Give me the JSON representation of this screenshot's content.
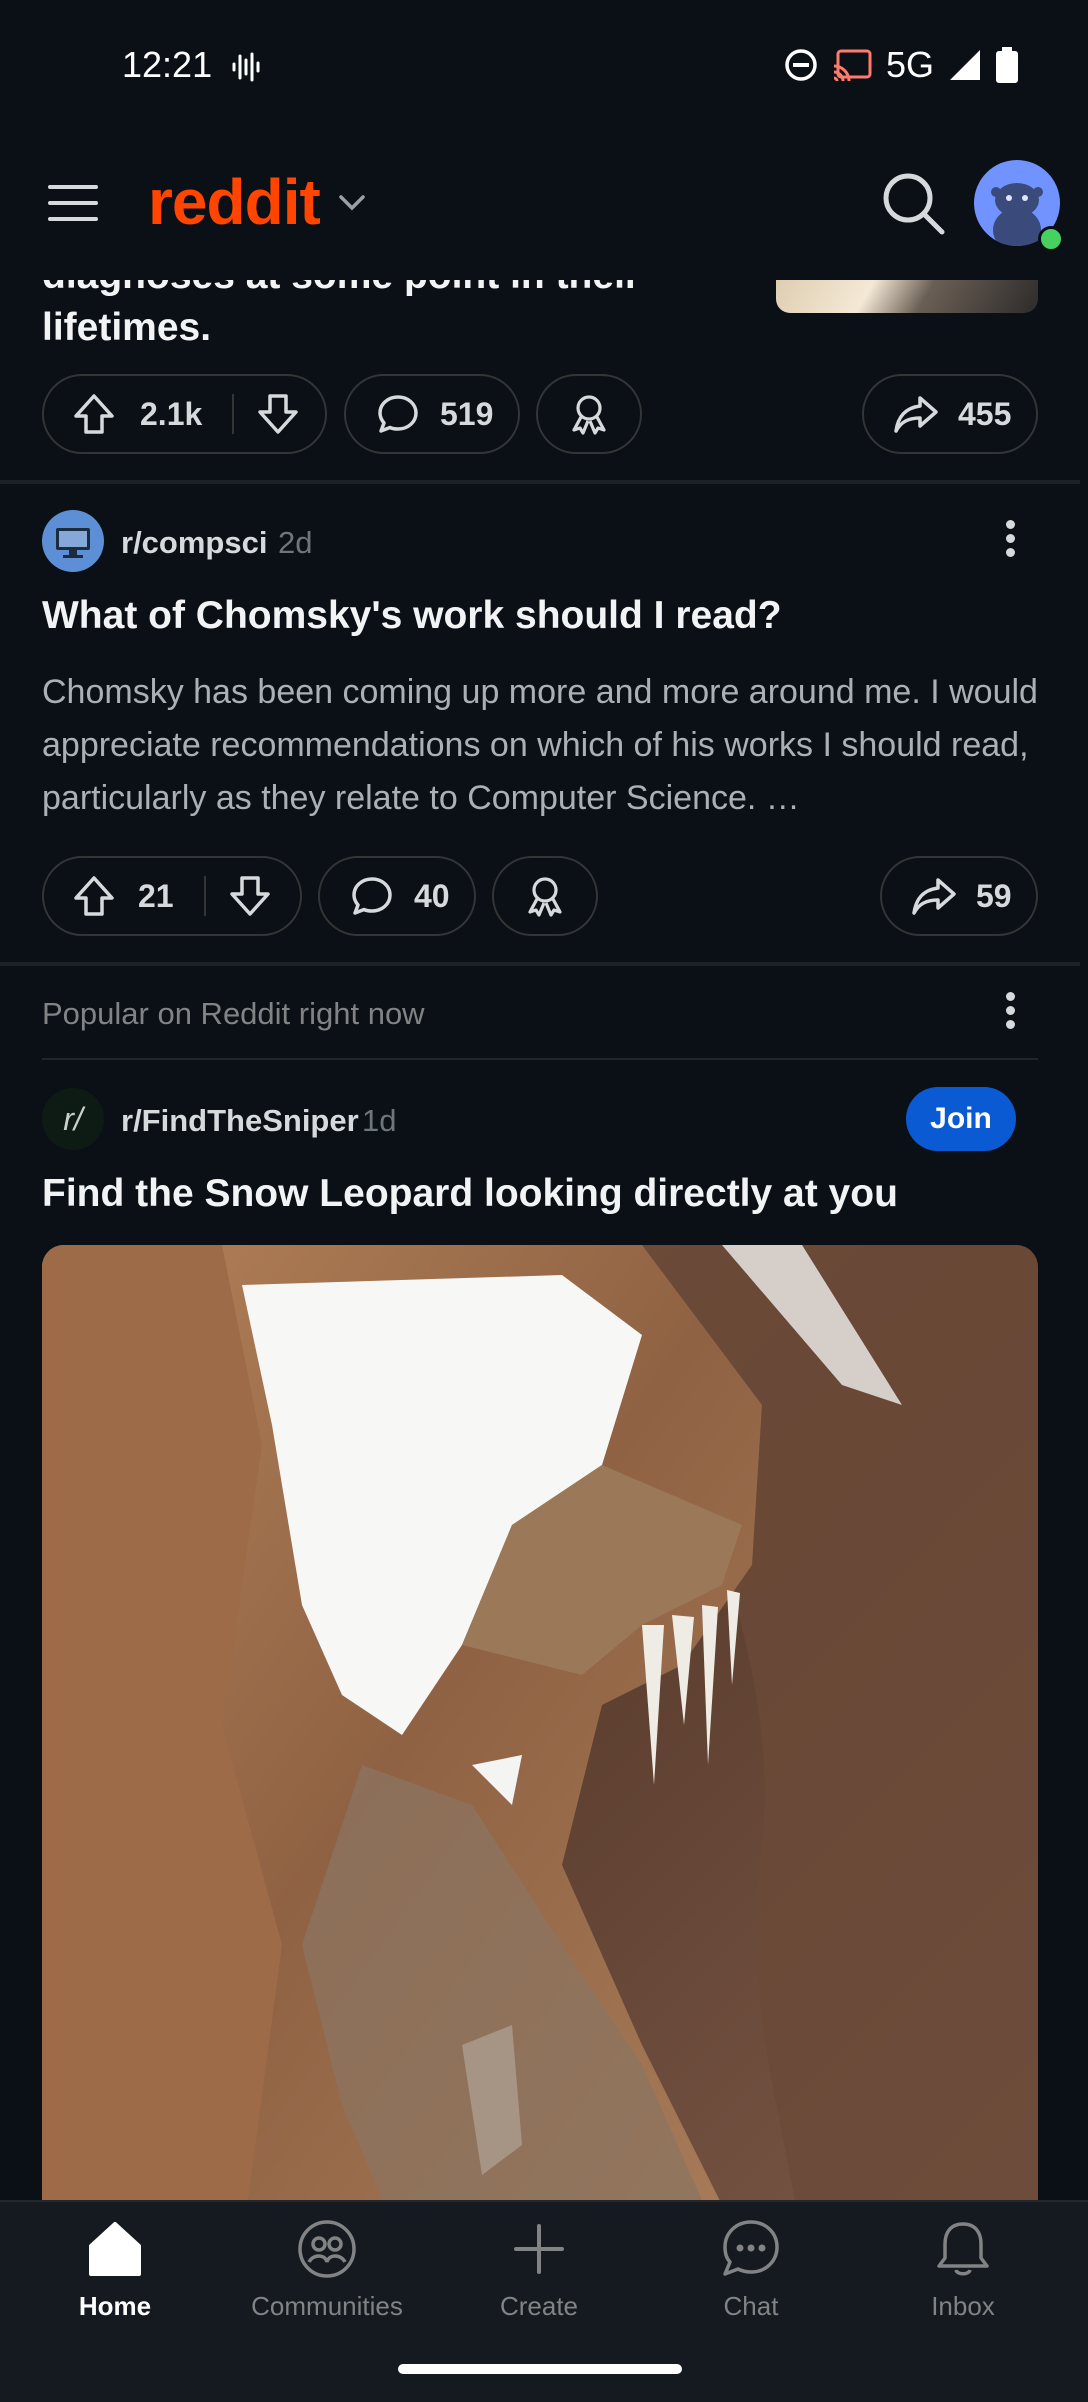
{
  "status": {
    "time": "12:21",
    "network": "5G"
  },
  "header": {
    "logo": "reddit"
  },
  "post1": {
    "title_partial": "diagnoses at some point in their lifetimes.",
    "upvotes": "2.1k",
    "comments": "519",
    "shares": "455"
  },
  "post2": {
    "subreddit": "r/compsci",
    "age": "2d",
    "title": "What of Chomsky's work should I read?",
    "body": "Chomsky has been coming up more and more around me. I would appreciate recommendations on which of his works I should read, particularly as they relate to Computer Science. …",
    "upvotes": "21",
    "comments": "40",
    "shares": "59"
  },
  "popular": {
    "heading": "Popular on Reddit right now",
    "subreddit": "r/FindTheSniper",
    "subreddit_avatar": "r/",
    "age": "1d",
    "join_label": "Join",
    "title": "Find the Snow Leopard looking directly at you"
  },
  "nav": {
    "home": "Home",
    "communities": "Communities",
    "create": "Create",
    "chat": "Chat",
    "inbox": "Inbox"
  },
  "colors": {
    "brand": "#ff4500",
    "join": "#0a5bd3",
    "online": "#46d160"
  }
}
